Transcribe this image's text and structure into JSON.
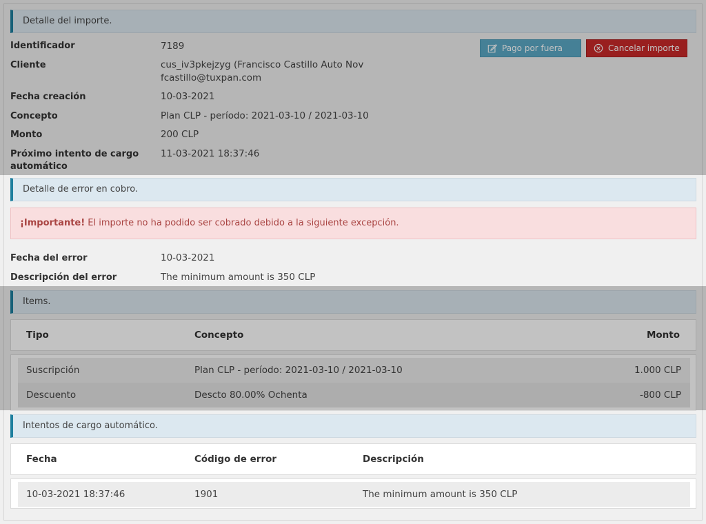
{
  "detail": {
    "header": "Detalle del importe.",
    "fields": [
      {
        "label": "Identificador",
        "value": "7189"
      },
      {
        "label": "Cliente",
        "value": "cus_iv3pkejzyg (Francisco Castillo Auto Nov",
        "value2": "fcastillo@tuxpan.com"
      },
      {
        "label": "Fecha creación",
        "value": "10-03-2021"
      },
      {
        "label": "Concepto",
        "value": "Plan CLP - período: 2021-03-10 / 2021-03-10"
      },
      {
        "label": "Monto",
        "value": "200 CLP"
      },
      {
        "label": "Próximo intento de cargo",
        "label2": "automático",
        "value": "11-03-2021 18:37:46"
      }
    ],
    "buttons": {
      "pay_outside": "Pago por fuera",
      "cancel": "Cancelar importe"
    }
  },
  "error": {
    "header": "Detalle de error en cobro.",
    "alert_strong": "¡Importante!",
    "alert_text": " El importe no ha podido ser cobrado debido a la siguiente excepción.",
    "fields": [
      {
        "label": "Fecha del error",
        "value": "10-03-2021"
      },
      {
        "label": "Descripción del error",
        "value": "The minimum amount is 350 CLP"
      }
    ]
  },
  "items": {
    "header": "Items.",
    "columns": [
      "Tipo",
      "Concepto",
      "Monto"
    ],
    "rows": [
      {
        "tipo": "Suscripción",
        "concepto": "Plan CLP - período: 2021-03-10 / 2021-03-10",
        "monto": "1.000 CLP"
      },
      {
        "tipo": "Descuento",
        "concepto": "Descto 80.00% Ochenta",
        "monto": "-800 CLP"
      }
    ]
  },
  "attempts": {
    "header": "Intentos de cargo automático.",
    "columns": [
      "Fecha",
      "Código de error",
      "Descripción"
    ],
    "rows": [
      {
        "fecha": "10-03-2021 18:37:46",
        "codigo": "1901",
        "descripcion": "The minimum amount is 350 CLP"
      }
    ]
  },
  "colors": {
    "accent": "#1e7f9e",
    "header_bg": "#dce8f0",
    "button_blue": "#5ba9c6",
    "button_red": "#c92a2a",
    "alert_bg": "#f9dedf",
    "alert_text": "#a94442"
  },
  "icons": {
    "pay_outside": "edit-icon",
    "cancel": "circle-x-icon"
  }
}
